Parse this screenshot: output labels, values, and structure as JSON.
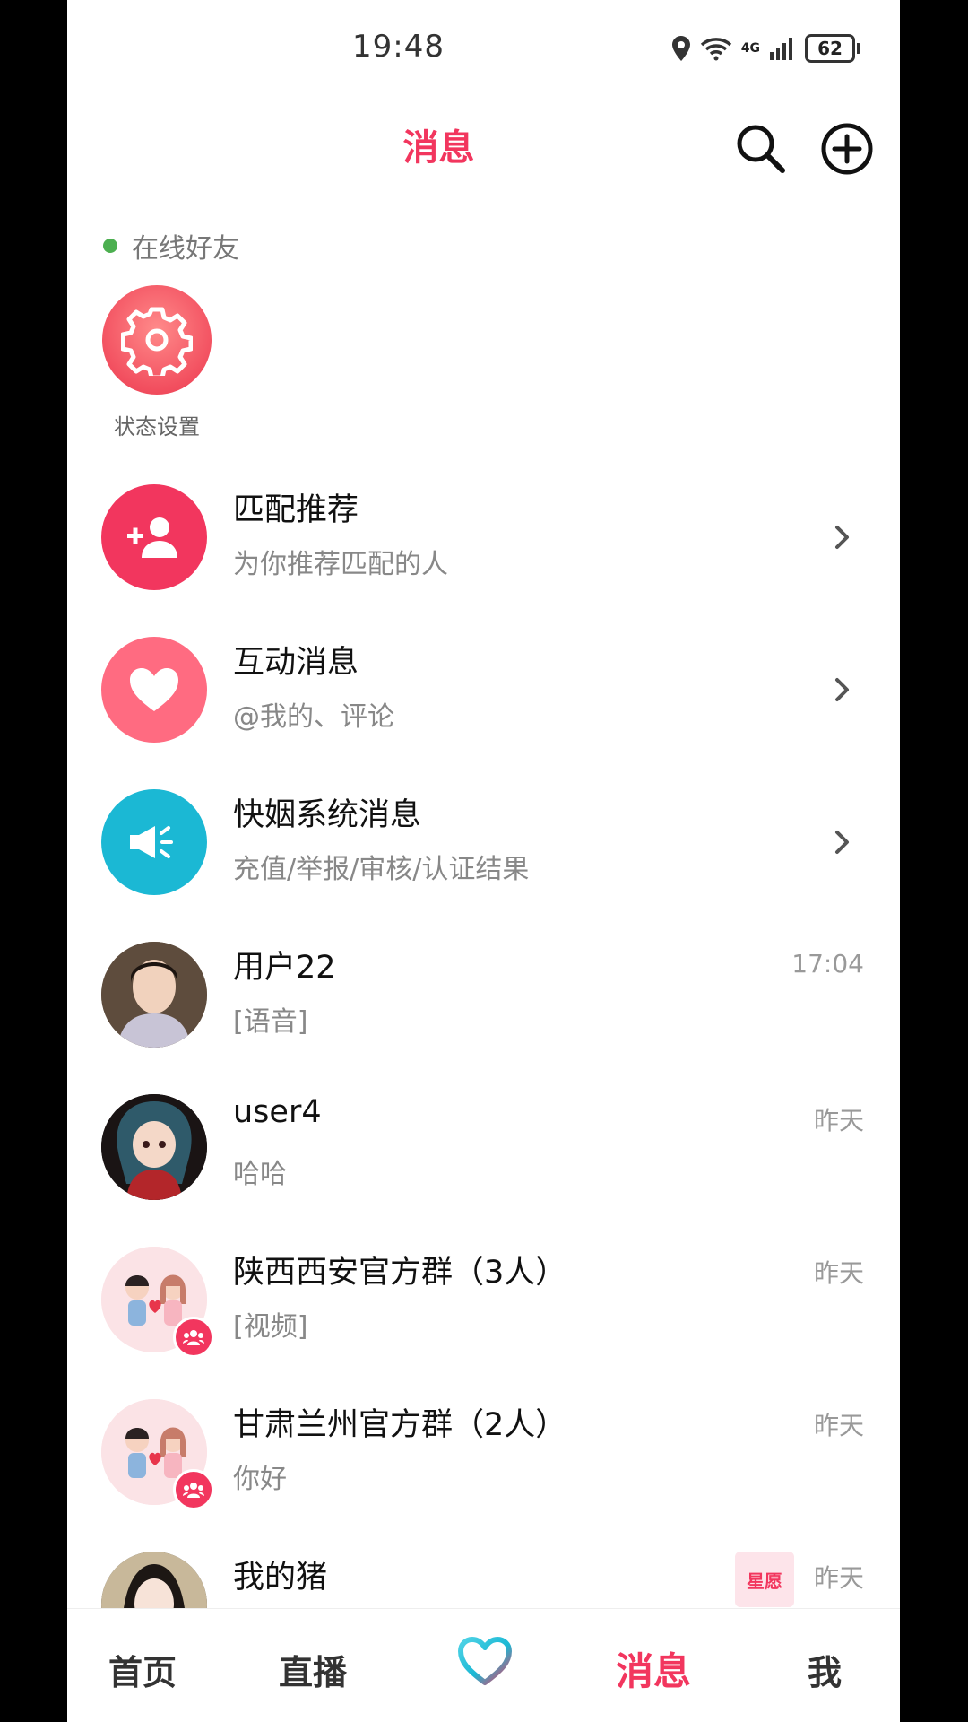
{
  "status_bar": {
    "time": "19:48",
    "network": "4G",
    "battery": "62"
  },
  "header": {
    "title": "消息"
  },
  "online": {
    "label": "在线好友",
    "setting_label": "状态设置"
  },
  "list": [
    {
      "title": "匹配推荐",
      "subtitle": "为你推荐匹配的人",
      "icon": "add-person-icon",
      "color": "#f2365e"
    },
    {
      "title": "互动消息",
      "subtitle": "@我的、评论",
      "icon": "heart-icon",
      "color": "#ff6b81"
    },
    {
      "title": "快姻系统消息",
      "subtitle": "充值/举报/审核/认证结果",
      "icon": "megaphone-icon",
      "color": "#1bb8d4"
    },
    {
      "title": "用户22",
      "subtitle": "[语音]",
      "time": "17:04"
    },
    {
      "title": "user4",
      "subtitle": "哈哈",
      "time": "昨天"
    },
    {
      "title": "陕西西安官方群（3人）",
      "subtitle": "[视频]",
      "time": "昨天"
    },
    {
      "title": "甘肃兰州官方群（2人）",
      "subtitle": "你好",
      "time": "昨天"
    },
    {
      "title": "我的猪",
      "tag": "星愿",
      "time": "昨天"
    }
  ],
  "nav": {
    "home": "首页",
    "live": "直播",
    "messages": "消息",
    "me": "我"
  },
  "colors": {
    "accent": "#f2365e",
    "online": "#4caf50",
    "system": "#1bb8d4"
  }
}
